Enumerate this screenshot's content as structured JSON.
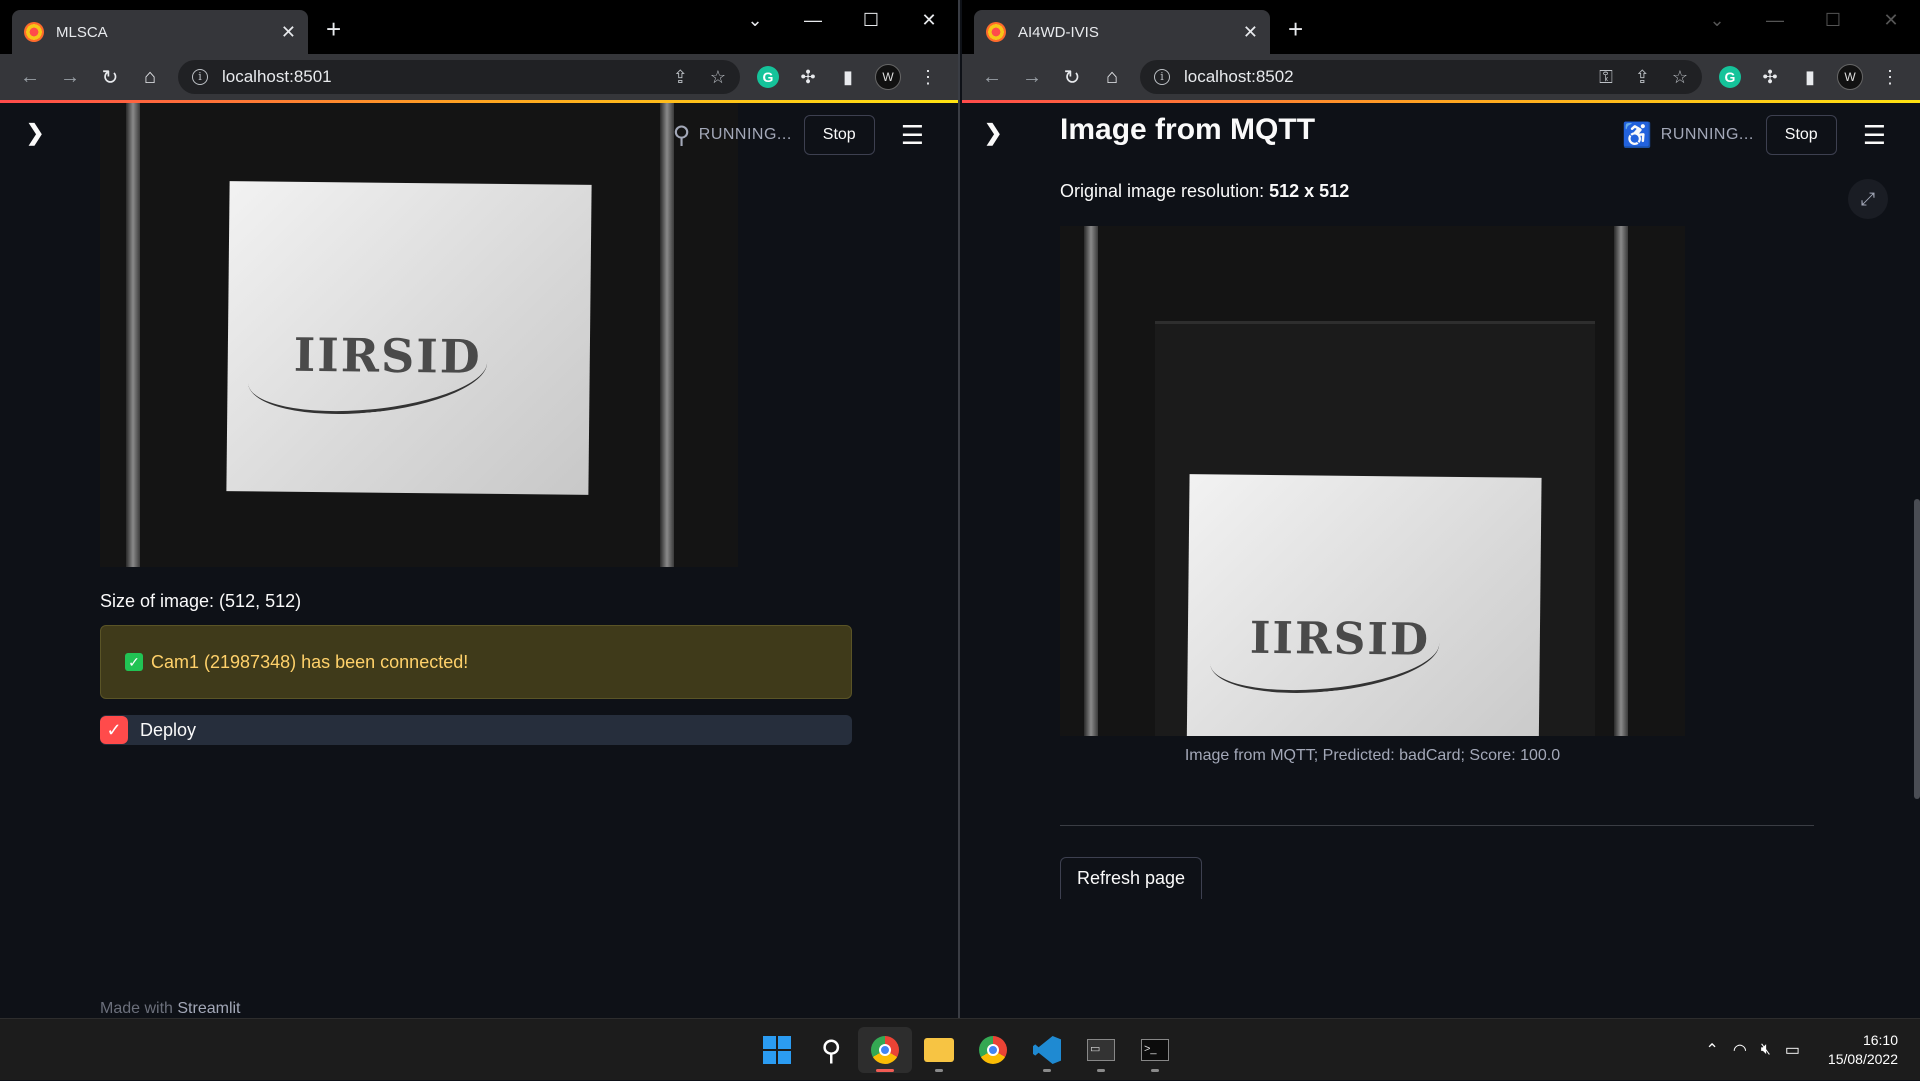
{
  "left_window": {
    "tab_title": "MLSCA",
    "url": "localhost:8501",
    "status": "RUNNING...",
    "stop_label": "Stop",
    "image_size_text": "Size of image: (512, 512)",
    "card_text": "IIRSID",
    "alert_text": "Cam1 (21987348) has been connected!",
    "deploy_label": "Deploy",
    "deploy_checked": true,
    "footer_prefix": "Made with",
    "footer_brand": "Streamlit"
  },
  "right_window": {
    "tab_title": "AI4WD-IVIS",
    "url": "localhost:8502",
    "status": "RUNNING...",
    "stop_label": "Stop",
    "page_title": "Image from MQTT",
    "resolution_label": "Original image resolution:",
    "resolution_value": "512 x 512",
    "card_text": "IIRSID",
    "caption": "Image from MQTT; Predicted: badCard; Score: 100.0",
    "refresh_label": "Refresh page"
  },
  "taskbar": {
    "time": "16:10",
    "date": "15/08/2022"
  },
  "colors": {
    "app_bg": "#0e1117",
    "streamlit_red": "#ff4b4b",
    "alert_bg": "#3f3a1a",
    "alert_text": "#ffd16a",
    "success_green": "#21c354"
  }
}
